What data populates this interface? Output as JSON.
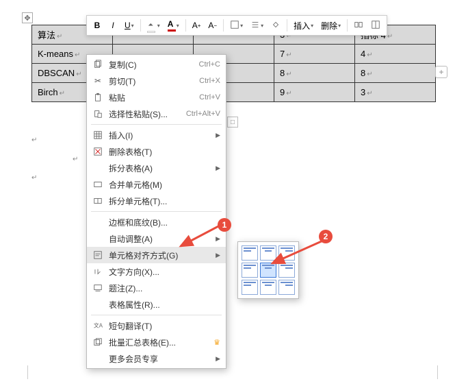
{
  "table": {
    "headers": [
      "算法",
      "",
      "",
      "",
      "指标 4"
    ],
    "partial_header_3": "3",
    "rows": [
      [
        "K-means",
        "",
        "",
        "7",
        "4"
      ],
      [
        "DBSCAN",
        "",
        "",
        "8",
        "8"
      ],
      [
        "Birch",
        "",
        "",
        "9",
        "3"
      ]
    ]
  },
  "toolbar": {
    "bold": "B",
    "italic": "I",
    "underline": "U",
    "font_inc": "A",
    "font_dec": "A",
    "insert": "插入",
    "delete": "删除"
  },
  "context_menu": {
    "items": [
      {
        "icon": "copy",
        "label": "复制(C)",
        "shortcut": "Ctrl+C"
      },
      {
        "icon": "cut",
        "label": "剪切(T)",
        "shortcut": "Ctrl+X"
      },
      {
        "icon": "paste",
        "label": "粘贴",
        "shortcut": "Ctrl+V"
      },
      {
        "icon": "paste-special",
        "label": "选择性粘贴(S)...",
        "shortcut": "Ctrl+Alt+V"
      }
    ],
    "group2": [
      {
        "icon": "insert-table",
        "label": "插入(I)",
        "submenu": true
      },
      {
        "icon": "delete-table",
        "label": "删除表格(T)"
      },
      {
        "icon": "",
        "label": "拆分表格(A)",
        "submenu": true
      },
      {
        "icon": "merge-cells",
        "label": "合并单元格(M)"
      },
      {
        "icon": "split-cells",
        "label": "拆分单元格(T)..."
      }
    ],
    "group3": [
      {
        "icon": "",
        "label": "边框和底纹(B)..."
      },
      {
        "icon": "",
        "label": "自动调整(A)",
        "submenu": true
      },
      {
        "icon": "align",
        "label": "单元格对齐方式(G)",
        "submenu": true,
        "highlight": true
      },
      {
        "icon": "text-dir",
        "label": "文字方向(X)..."
      },
      {
        "icon": "caption",
        "label": "题注(Z)..."
      },
      {
        "icon": "",
        "label": "表格属性(R)..."
      }
    ],
    "group4": [
      {
        "icon": "translate",
        "label": "短句翻译(T)"
      },
      {
        "icon": "batch",
        "label": "批量汇总表格(E)...",
        "crown": true
      },
      {
        "icon": "",
        "label": "更多会员专享",
        "submenu": true
      }
    ]
  },
  "annotations": {
    "b1": "1",
    "b2": "2"
  },
  "handles": {
    "plus": "+",
    "move": "✥",
    "square": "□"
  }
}
